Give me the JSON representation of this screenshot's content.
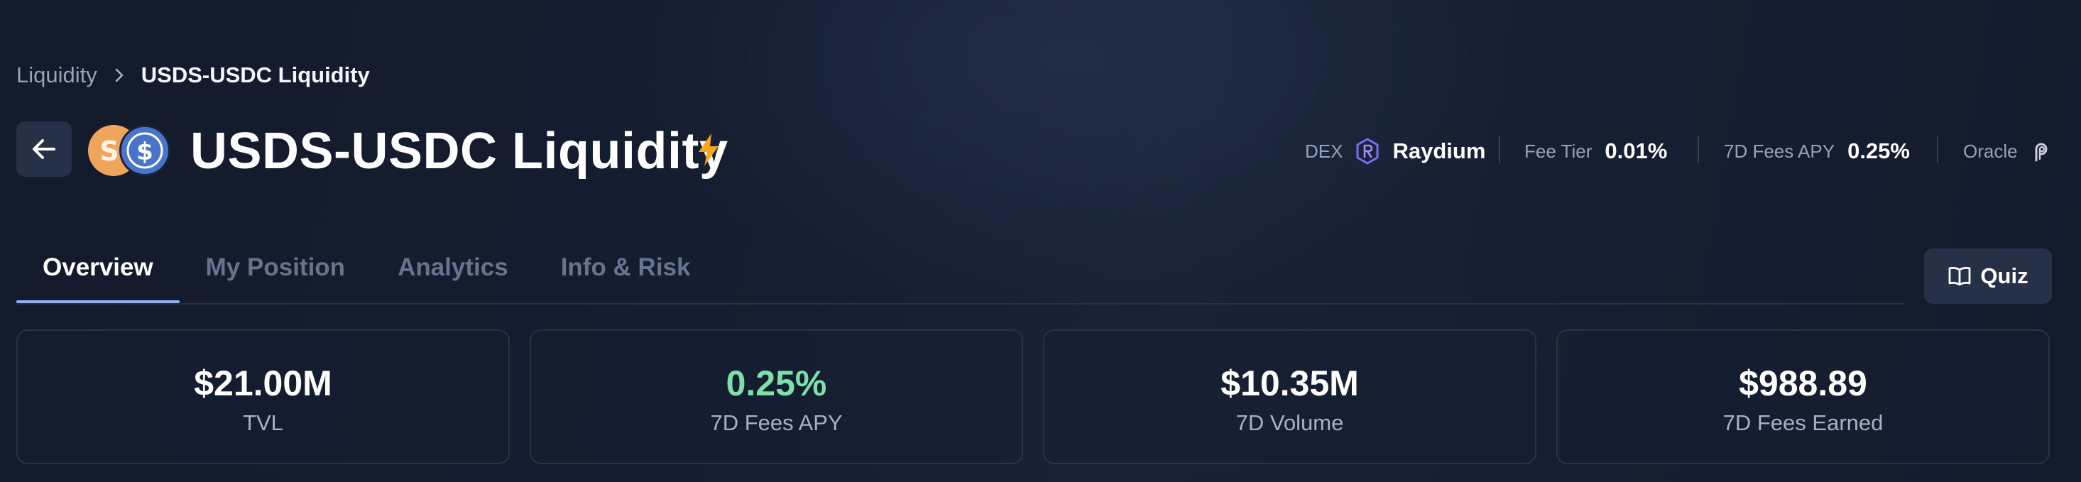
{
  "breadcrumb": {
    "parent": "Liquidity",
    "current": "USDS-USDC Liquidity"
  },
  "header": {
    "title": "USDS-USDC Liquidity"
  },
  "tokens": {
    "a_glyph": "S",
    "b_glyph": "$"
  },
  "meta": {
    "dex_label": "DEX",
    "dex_value": "Raydium",
    "fee_tier_label": "Fee Tier",
    "fee_tier_value": "0.01%",
    "fees_apy_label": "7D Fees APY",
    "fees_apy_value": "0.25%",
    "oracle_label": "Oracle"
  },
  "tabs": [
    {
      "label": "Overview",
      "active": true
    },
    {
      "label": "My Position",
      "active": false
    },
    {
      "label": "Analytics",
      "active": false
    },
    {
      "label": "Info & Risk",
      "active": false
    }
  ],
  "quiz": {
    "label": "Quiz"
  },
  "stats": [
    {
      "value": "$21.00M",
      "label": "TVL"
    },
    {
      "value": "0.25%",
      "label": "7D Fees APY"
    },
    {
      "value": "$10.35M",
      "label": "7D Volume"
    },
    {
      "value": "$988.89",
      "label": "7D Fees Earned"
    }
  ],
  "colors": {
    "accent_green": "#7ee0a8",
    "tab_active_underline": "#8db4f0",
    "bolt": "#f5a623",
    "usds_token": "#f0a55c",
    "usdc_token": "#4a74c9"
  }
}
